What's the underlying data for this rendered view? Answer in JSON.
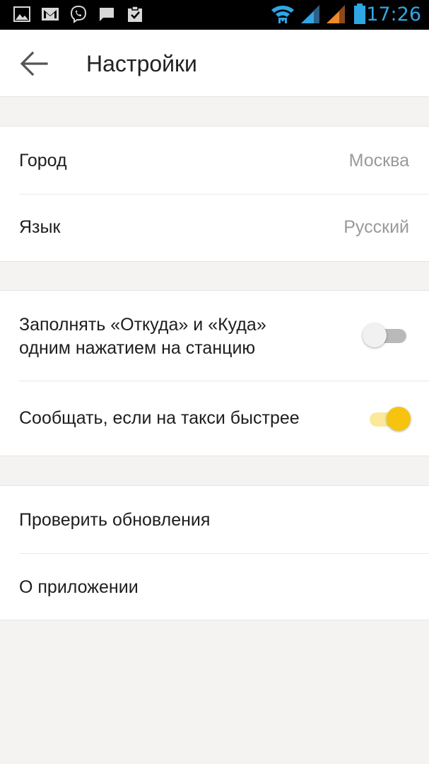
{
  "status_bar": {
    "time": "17:26",
    "icons": [
      "gallery-icon",
      "gmail-icon",
      "viber-icon",
      "message-icon",
      "clipboard-check-icon",
      "wifi-icon",
      "signal-sim1-icon",
      "signal-sim2-icon",
      "battery-icon"
    ]
  },
  "header": {
    "back_icon": "arrow-left-icon",
    "title": "Настройки"
  },
  "groups": {
    "general": {
      "city": {
        "label": "Город",
        "value": "Москва"
      },
      "language": {
        "label": "Язык",
        "value": "Русский"
      }
    },
    "toggles": {
      "fill_stations": {
        "label_line1": "Заполнять «Откуда» и «Куда»",
        "label_line2": "одним нажатием на станцию",
        "enabled": false
      },
      "taxi_faster": {
        "label": "Сообщать, если на такси быстрее",
        "enabled": true
      }
    },
    "about": {
      "check_updates": {
        "label": "Проверить обновления"
      },
      "about_app": {
        "label": "О приложении"
      }
    }
  },
  "colors": {
    "accent": "#f6c40e",
    "accent_track": "#fbe89a",
    "time": "#2fa7e5",
    "background": "#f4f3f2"
  }
}
